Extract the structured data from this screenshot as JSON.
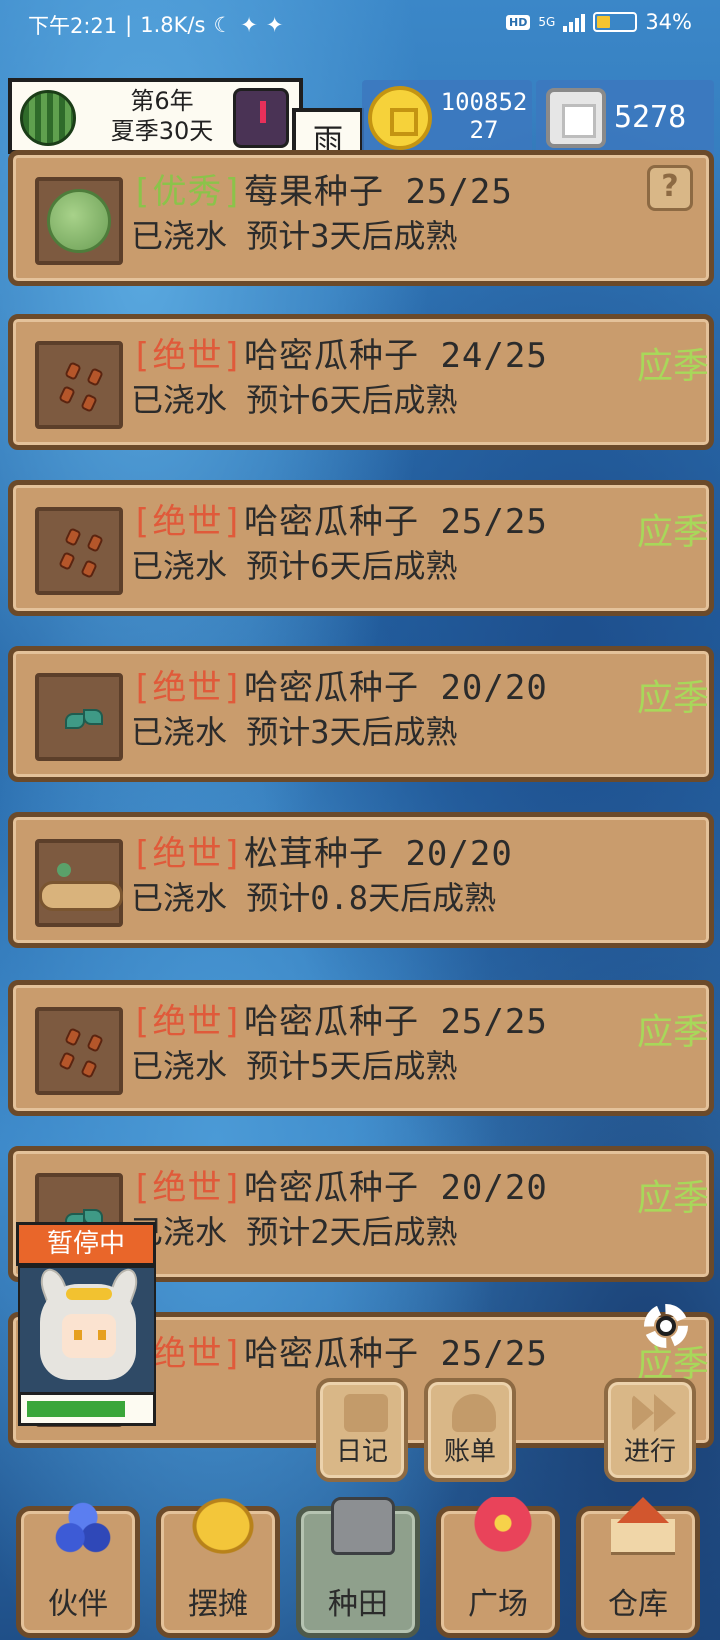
{
  "status_bar": {
    "time": "下午2:21",
    "speed": "1.8K/s",
    "network": "5G",
    "hd": "HD",
    "battery_percent": "34%",
    "battery_level": 0.34
  },
  "hud": {
    "year": "第6年",
    "season_day": "夏季30天",
    "weather": "雨",
    "coins": "100852",
    "coins_sub": "27",
    "gems": "5278"
  },
  "plots": [
    {
      "rarity": "[优秀]",
      "rarity_class": "good",
      "name": "莓果种子",
      "count": "25/25",
      "status": "已浇水 预计3天后成熟",
      "season": "",
      "icon": "bush",
      "has_help": true
    },
    {
      "rarity": "[绝世]",
      "rarity_class": "epic",
      "name": "哈密瓜种子",
      "count": "24/25",
      "status": "已浇水 预计6天后成熟",
      "season": "应季",
      "icon": "seeds",
      "has_help": false
    },
    {
      "rarity": "[绝世]",
      "rarity_class": "epic",
      "name": "哈密瓜种子",
      "count": "25/25",
      "status": "已浇水 预计6天后成熟",
      "season": "应季",
      "icon": "seeds",
      "has_help": false
    },
    {
      "rarity": "[绝世]",
      "rarity_class": "epic",
      "name": "哈密瓜种子",
      "count": "20/20",
      "status": "已浇水 预计3天后成熟",
      "season": "应季",
      "icon": "sprout",
      "has_help": false
    },
    {
      "rarity": "[绝世]",
      "rarity_class": "epic",
      "name": "松茸种子",
      "count": "20/20",
      "status": "已浇水 预计0.8天后成熟",
      "season": "",
      "icon": "log",
      "has_help": false
    },
    {
      "rarity": "[绝世]",
      "rarity_class": "epic",
      "name": "哈密瓜种子",
      "count": "25/25",
      "status": "已浇水 预计5天后成熟",
      "season": "应季",
      "icon": "seeds",
      "has_help": false
    },
    {
      "rarity": "[绝世]",
      "rarity_class": "epic",
      "name": "哈密瓜种子",
      "count": "20/20",
      "status": "已浇水 预计2天后成熟",
      "season": "应季",
      "icon": "sprout",
      "has_help": false
    },
    {
      "rarity": "[绝世]",
      "rarity_class": "epic",
      "name": "哈密瓜种子",
      "count": "25/25",
      "status": "",
      "season": "应季",
      "icon": "seeds",
      "has_help": false
    }
  ],
  "companion": {
    "state_label": "暂停中",
    "hp_fraction": 0.82
  },
  "actions": {
    "diary": "日记",
    "ledger": "账单",
    "proceed": "进行"
  },
  "nav": {
    "partner": "伙伴",
    "stall": "摆摊",
    "farm": "种田",
    "plaza": "广场",
    "warehouse": "仓库",
    "active": "farm"
  }
}
